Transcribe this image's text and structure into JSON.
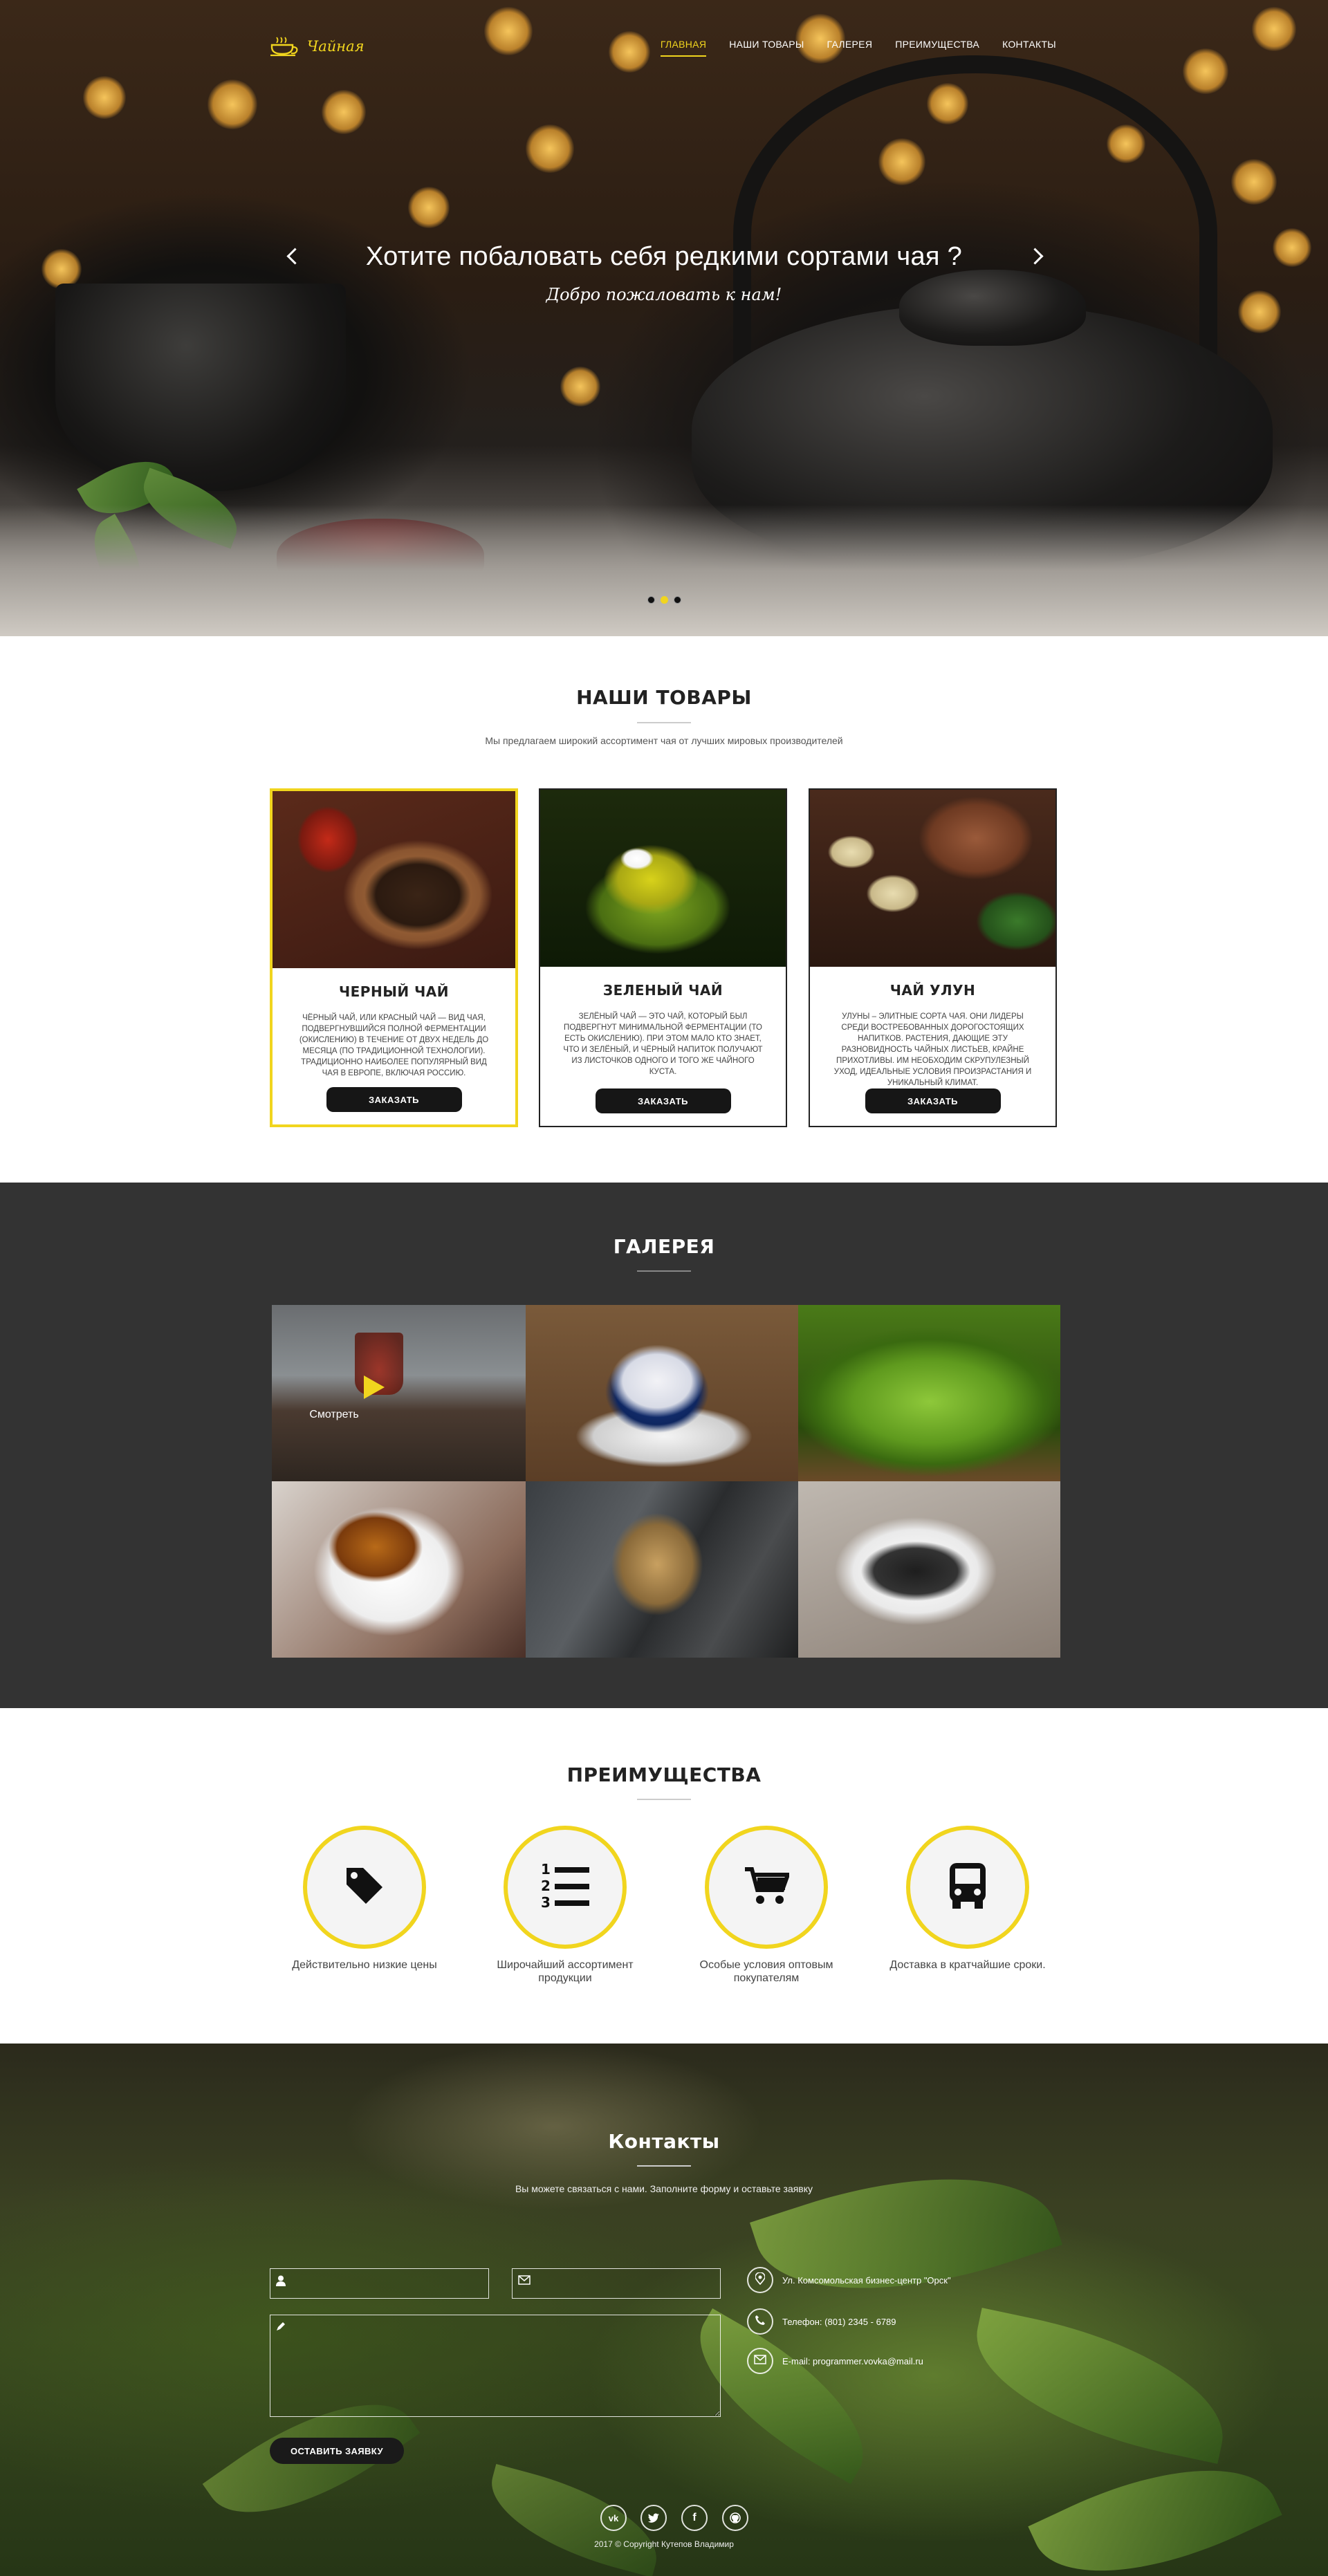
{
  "brand": {
    "name": "Чайная",
    "accent": "#f1d51e"
  },
  "nav": {
    "items": [
      {
        "label": "ГЛАВНАЯ",
        "active": true
      },
      {
        "label": "НАШИ ТОВАРЫ",
        "active": false
      },
      {
        "label": "ГАЛЕРЕЯ",
        "active": false
      },
      {
        "label": "ПРЕИМУЩЕСТВА",
        "active": false
      },
      {
        "label": "КОНТАКТЫ",
        "active": false
      }
    ]
  },
  "hero": {
    "title": "Хотите побаловать себя редкими сортами чая ?",
    "subtitle": "Добро пожаловать к нам!",
    "slides_total": 3,
    "active_slide": 2
  },
  "products": {
    "title": "НАШИ ТОВАРЫ",
    "subtitle": "Мы предлагаем широкий ассортимент чая от лучших мировых производителей",
    "items": [
      {
        "name": "ЧЕРНЫЙ ЧАЙ",
        "description": "ЧЁРНЫЙ ЧАЙ, ИЛИ КРАСНЫЙ ЧАЙ — ВИД ЧАЯ, ПОДВЕРГНУВШИЙСЯ ПОЛНОЙ ФЕРМЕНТАЦИИ (ОКИСЛЕНИЮ) В ТЕЧЕНИЕ ОТ ДВУХ НЕДЕЛЬ ДО МЕСЯЦА (ПО ТРАДИЦИОННОЙ ТЕХНОЛОГИИ). ТРАДИЦИОННО НАИБОЛЕЕ ПОПУЛЯРНЫЙ ВИД ЧАЯ В ЕВРОПЕ, ВКЛЮЧАЯ РОССИЮ.",
        "button": "ЗАКАЗАТЬ"
      },
      {
        "name": "ЗЕЛЕНЫЙ ЧАЙ",
        "description": "ЗЕЛЁНЫЙ ЧАЙ — ЭТО ЧАЙ, КОТОРЫЙ БЫЛ ПОДВЕРГНУТ МИНИМАЛЬНОЙ ФЕРМЕНТАЦИИ (ТО ЕСТЬ ОКИСЛЕНИЮ). ПРИ ЭТОМ МАЛО КТО ЗНАЕТ, ЧТО И ЗЕЛЁНЫЙ, И ЧЁРНЫЙ НАПИТОК ПОЛУЧАЮТ ИЗ ЛИСТОЧКОВ ОДНОГО И ТОГО ЖЕ ЧАЙНОГО КУСТА.",
        "button": "ЗАКАЗАТЬ"
      },
      {
        "name": "ЧАЙ УЛУН",
        "description": "УЛУНЫ – ЭЛИТНЫЕ СОРТА ЧАЯ. ОНИ ЛИДЕРЫ СРЕДИ ВОСТРЕБОВАННЫХ ДОРОГОСТОЯЩИХ НАПИТКОВ. РАСТЕНИЯ, ДАЮЩИЕ ЭТУ РАЗНОВИДНОСТЬ ЧАЙНЫХ ЛИСТЬЕВ, КРАЙНЕ ПРИХОТЛИВЫ. ИМ НЕОБХОДИМ СКРУПУЛЕЗНЫЙ УХОД, ИДЕАЛЬНЫЕ УСЛОВИЯ ПРОИЗРАСТАНИЯ И УНИКАЛЬНЫЙ КЛИМАТ.",
        "button": "ЗАКАЗАТЬ"
      }
    ]
  },
  "gallery": {
    "title": "ГАЛЕРЕЯ",
    "watch_label": "Смотреть",
    "background": "#333333"
  },
  "advantages": {
    "title": "ПРЕИМУЩЕСТВА",
    "items": [
      {
        "icon": "price-tag-icon",
        "label": "Действительно низкие цены"
      },
      {
        "icon": "numbered-list-icon",
        "label": "Широчайший ассортимент продукции"
      },
      {
        "icon": "shopping-cart-icon",
        "label": "Особые условия оптовым покупателям"
      },
      {
        "icon": "bus-icon",
        "label": "Доставка в кратчайшие сроки."
      }
    ]
  },
  "contacts": {
    "title": "Контакты",
    "subtitle": "Вы можете связаться с нами. Заполните форму и оставьте заявку",
    "submit": "ОСТАВИТЬ ЗАЯВКУ",
    "address": "Ул. Комсомольская бизнес-центр \"Орск\"",
    "phone": "Телефон: (801) 2345 - 6789",
    "email": "E-mail: programmer.vovka@mail.ru",
    "social": [
      {
        "icon": "vk-icon",
        "label": "vk"
      },
      {
        "icon": "twitter-icon",
        "label": "t"
      },
      {
        "icon": "facebook-icon",
        "label": "f"
      },
      {
        "icon": "github-icon",
        "label": "gh"
      }
    ],
    "copyright": "2017 © Copyright Кутепов Владимир"
  }
}
